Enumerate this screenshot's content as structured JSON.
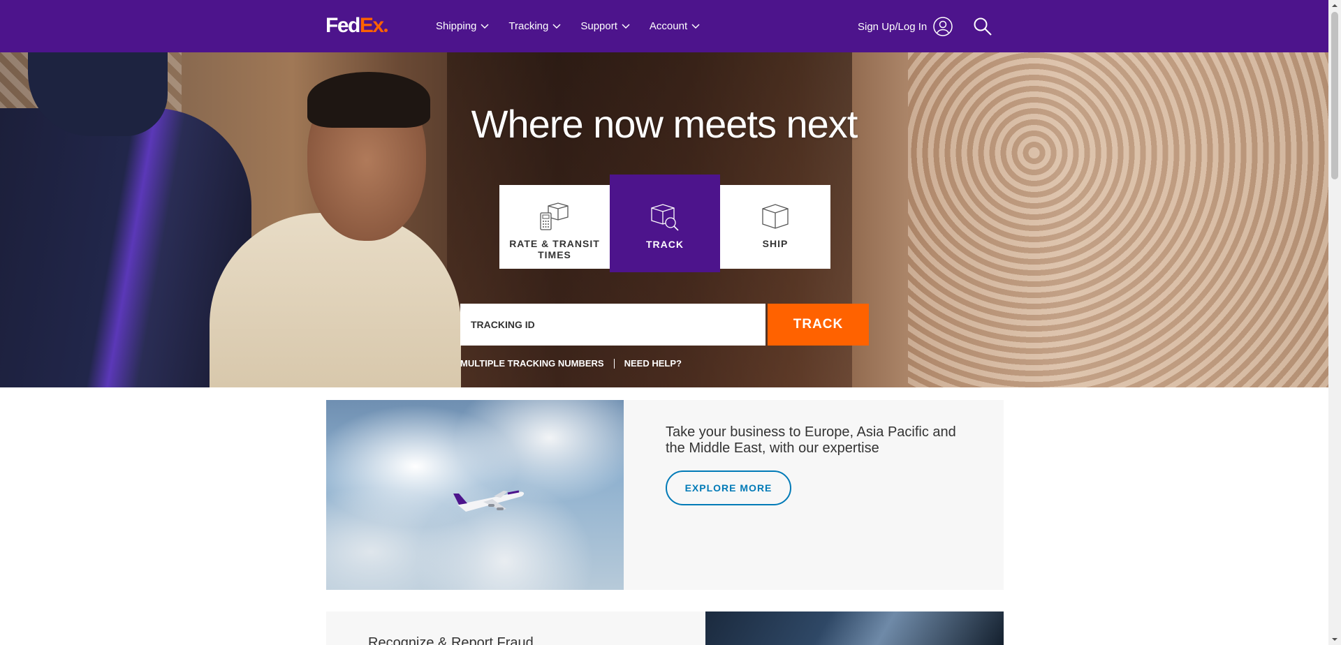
{
  "header": {
    "logo": {
      "fed": "Fed",
      "ex": "Ex"
    },
    "nav": [
      {
        "label": "Shipping"
      },
      {
        "label": "Tracking"
      },
      {
        "label": "Support"
      },
      {
        "label": "Account"
      }
    ],
    "signin_label": "Sign Up/Log In"
  },
  "hero": {
    "headline": "Where now meets next",
    "tabs": [
      {
        "label": "RATE & TRANSIT TIMES",
        "icon": "calculator-box-icon"
      },
      {
        "label": "TRACK",
        "icon": "box-magnifier-icon",
        "active": true
      },
      {
        "label": "SHIP",
        "icon": "box-icon"
      }
    ],
    "tracking_placeholder": "TRACKING ID",
    "track_button": "TRACK",
    "links": {
      "multiple": "MULTIPLE TRACKING NUMBERS",
      "help": "NEED HELP?"
    }
  },
  "promo": {
    "text": "Take your business to Europe, Asia Pacific and the Middle East, with our expertise",
    "button": "EXPLORE MORE"
  },
  "fraud": {
    "title": "Recognize & Report Fraud"
  },
  "colors": {
    "brand_purple": "#4d148c",
    "brand_orange": "#ff6200",
    "link_blue": "#007ab7"
  }
}
